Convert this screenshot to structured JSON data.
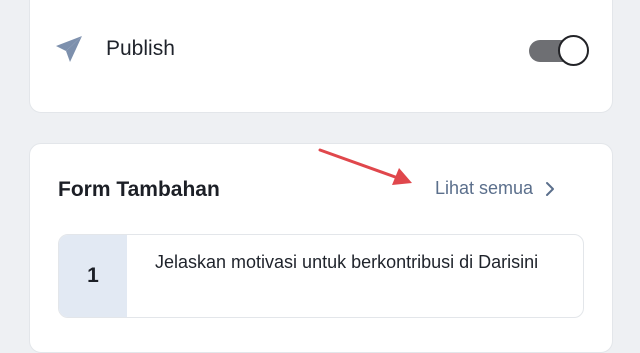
{
  "publish": {
    "icon": "send-icon",
    "label": "Publish",
    "toggle_on": true
  },
  "form": {
    "title": "Form Tambahan",
    "see_all_label": "Lihat semua",
    "see_all_icon": "chevron-right-icon",
    "questions": [
      {
        "number": "1",
        "text": "Jelaskan motivasi untuk berkontribusi di Darisini"
      }
    ]
  },
  "colors": {
    "background": "#eef0f3",
    "card": "#ffffff",
    "toggle_track": "#6e6f73",
    "link": "#5b6f8c",
    "number_bg": "#e2e9f3",
    "annotation_arrow": "#e0474c",
    "send_icon": "#7d90ad"
  }
}
